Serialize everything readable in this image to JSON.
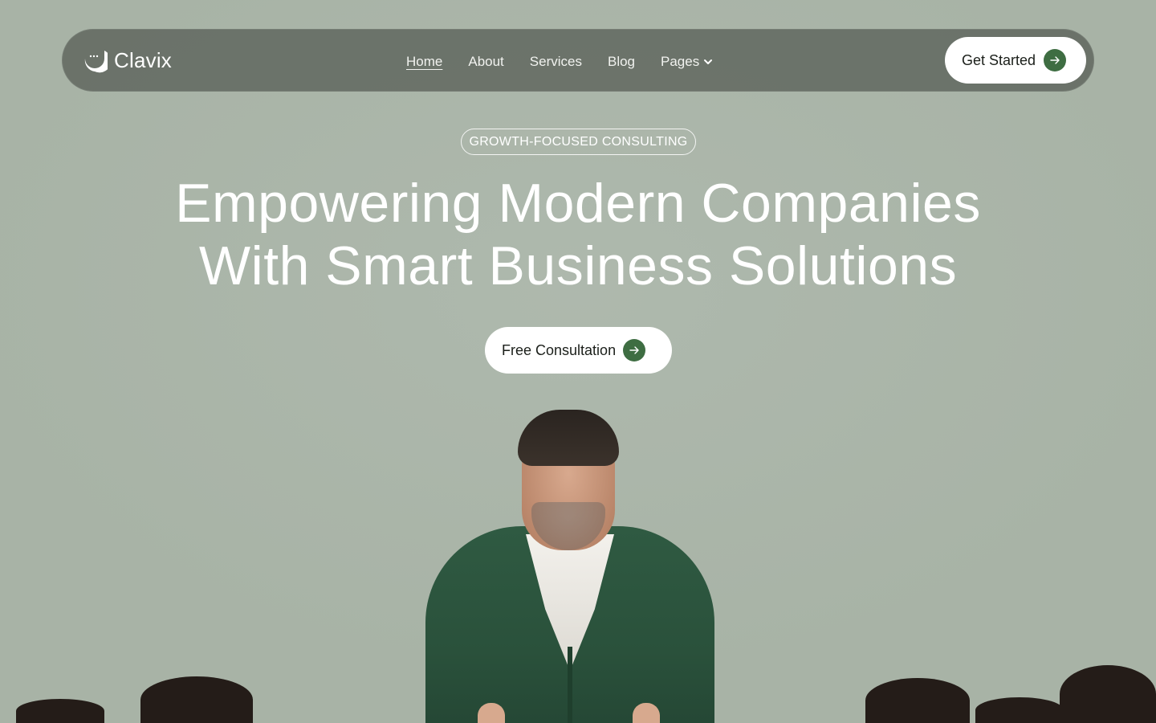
{
  "brand": {
    "name": "Clavix",
    "logo_icon": "smile-cup-icon"
  },
  "nav": {
    "items": [
      {
        "label": "Home",
        "active": true
      },
      {
        "label": "About",
        "active": false
      },
      {
        "label": "Services",
        "active": false
      },
      {
        "label": "Blog",
        "active": false
      },
      {
        "label": "Pages",
        "active": false,
        "has_dropdown": true
      }
    ],
    "cta_label": "Get Started"
  },
  "hero": {
    "badge": "GROWTH-FOCUSED CONSULTING",
    "headline_line1": "Empowering Modern Companies",
    "headline_line2": "With Smart Business Solutions",
    "button_label": "Free Consultation"
  },
  "colors": {
    "accent": "#3e6d42",
    "navbar": "#5a6058",
    "background": "#a8b3a6"
  }
}
